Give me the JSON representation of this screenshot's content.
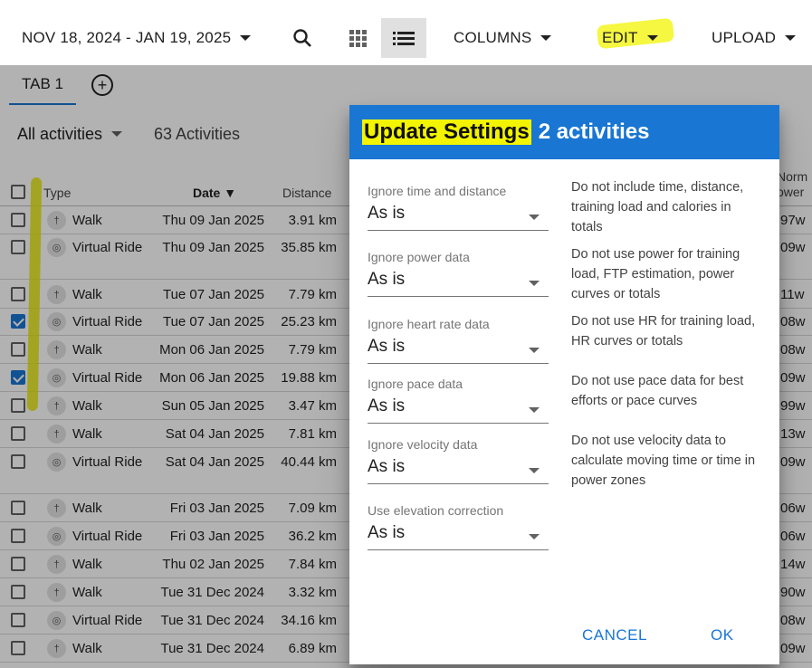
{
  "toolbar": {
    "date_range": "NOV 18, 2024 - JAN 19, 2025",
    "columns_label": "COLUMNS",
    "edit_label": "EDIT",
    "upload_label": "UPLOAD"
  },
  "tabs": [
    {
      "label": "TAB 1"
    }
  ],
  "filter": {
    "selected": "All activities",
    "count": "63 Activities"
  },
  "table": {
    "headers": {
      "type": "Type",
      "date": "Date",
      "distance": "Distance",
      "norm_a": "Norm",
      "norm_b": "ower"
    },
    "rows": [
      {
        "type": "Walk",
        "icon": "walk-icon",
        "date": "Thu 09 Jan 2025",
        "distance": "3.91 km",
        "power": "97w",
        "checked": false
      },
      {
        "type": "Virtual Ride",
        "icon": "bike-icon",
        "date": "Thu 09 Jan 2025",
        "distance": "35.85 km",
        "power": "09w",
        "checked": false
      },
      {
        "type": "Walk",
        "icon": "walk-icon",
        "date": "Tue 07 Jan 2025",
        "distance": "7.79 km",
        "power": "11w",
        "checked": false
      },
      {
        "type": "Virtual Ride",
        "icon": "bike-icon",
        "date": "Tue 07 Jan 2025",
        "distance": "25.23 km",
        "power": "08w",
        "checked": true
      },
      {
        "type": "Walk",
        "icon": "walk-icon",
        "date": "Mon 06 Jan 2025",
        "distance": "7.79 km",
        "power": "08w",
        "checked": false
      },
      {
        "type": "Virtual Ride",
        "icon": "bike-icon",
        "date": "Mon 06 Jan 2025",
        "distance": "19.88 km",
        "power": "09w",
        "checked": true
      },
      {
        "type": "Walk",
        "icon": "walk-icon",
        "date": "Sun 05 Jan 2025",
        "distance": "3.47 km",
        "power": "99w",
        "checked": false
      },
      {
        "type": "Walk",
        "icon": "walk-icon",
        "date": "Sat 04 Jan 2025",
        "distance": "7.81 km",
        "power": "13w",
        "checked": false
      },
      {
        "type": "Virtual Ride",
        "icon": "bike-icon",
        "date": "Sat 04 Jan 2025",
        "distance": "40.44 km",
        "power": "09w",
        "checked": false
      },
      {
        "type": "Walk",
        "icon": "walk-icon",
        "date": "Fri 03 Jan 2025",
        "distance": "7.09 km",
        "power": "06w",
        "checked": false
      },
      {
        "type": "Virtual Ride",
        "icon": "bike-icon",
        "date": "Fri 03 Jan 2025",
        "distance": "36.2 km",
        "power": "06w",
        "checked": false
      },
      {
        "type": "Walk",
        "icon": "walk-icon",
        "date": "Thu 02 Jan 2025",
        "distance": "7.84 km",
        "power": "14w",
        "checked": false
      },
      {
        "type": "Walk",
        "icon": "walk-icon",
        "date": "Tue 31 Dec 2024",
        "distance": "3.32 km",
        "power": "90w",
        "checked": false
      },
      {
        "type": "Virtual Ride",
        "icon": "bike-icon",
        "date": "Tue 31 Dec 2024",
        "distance": "34.16 km",
        "power": "08w",
        "checked": false
      },
      {
        "type": "Walk",
        "icon": "walk-icon",
        "date": "Tue 31 Dec 2024",
        "distance": "6.89 km",
        "power": "09w",
        "checked": false
      }
    ]
  },
  "dialog": {
    "title_highlight": "Update Settings",
    "title_rest": "2 activities",
    "fields": [
      {
        "label": "Ignore time and distance",
        "value": "As is",
        "description": "Do not include time, distance, training load and calories in totals"
      },
      {
        "label": "Ignore power data",
        "value": "As is",
        "description": "Do not use power for training load, FTP estimation, power curves or totals"
      },
      {
        "label": "Ignore heart rate data",
        "value": "As is",
        "description": "Do not use HR for training load, HR curves or totals"
      },
      {
        "label": "Ignore pace data",
        "value": "As is",
        "description": "Do not use pace data for best efforts or pace curves"
      },
      {
        "label": "Ignore velocity data",
        "value": "As is",
        "description": "Do not use velocity data to calculate moving time or time in power zones"
      },
      {
        "label": "Use elevation correction",
        "value": "As is",
        "description": ""
      }
    ],
    "cancel_label": "CANCEL",
    "ok_label": "OK"
  },
  "colors": {
    "accent": "#1976d2",
    "highlight": "#f2f400",
    "scrim": "rgba(0,0,0,0.30)"
  }
}
